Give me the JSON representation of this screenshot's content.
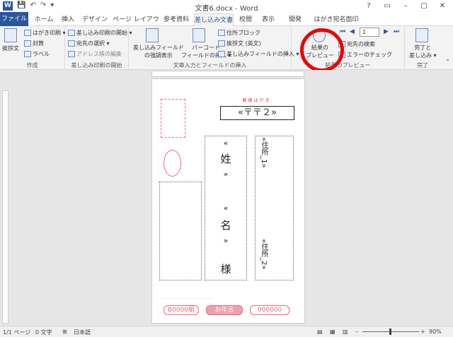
{
  "window": {
    "title": "文書6.docx - Word",
    "controls": [
      "?",
      "▭",
      "–",
      "□",
      "✕"
    ]
  },
  "tabs": [
    {
      "label": "ファイル"
    },
    {
      "label": "ホーム"
    },
    {
      "label": "挿入"
    },
    {
      "label": "デザイン"
    },
    {
      "label": "ページ レイアウト"
    },
    {
      "label": "参考資料"
    },
    {
      "label": "差し込み文書"
    },
    {
      "label": "校閲"
    },
    {
      "label": "表示"
    },
    {
      "label": "開発"
    },
    {
      "label": "はがき宛名面印刷"
    }
  ],
  "ribbon": {
    "create": {
      "label": "作成",
      "greeting": "挨拶文",
      "postcard_print": "はがき印刷",
      "envelope": "封筒",
      "labels": "ラベル"
    },
    "start_merge": {
      "label": "差し込み印刷の開始",
      "start": "差し込み印刷の開始",
      "select_recipients": "宛先の選択",
      "edit_list": "アドレス帳の編集"
    },
    "fields": {
      "label": "文章入力とフィールドの挿入",
      "highlight_line1": "差し込みフィールド",
      "highlight_line2": "の強調表示",
      "barcode_line1": "バーコード",
      "barcode_line2": "フィールドの挿入",
      "address_block": "住所ブロック",
      "greeting_en": "挨拶文 (英文)",
      "insert_field": "差し込みフィールドの挿入"
    },
    "preview": {
      "label": "結果のプレビュー",
      "button_line1": "結果の",
      "button_line2": "プレビュー",
      "record": "1",
      "find_recipient": "宛先の検索",
      "check_errors": "エラーのチェック"
    },
    "finish": {
      "label": "完了",
      "button_line1": "完了と",
      "button_line2": "差し込み"
    }
  },
  "document": {
    "postal_header": "郵便はがき",
    "zip_field": "«〒〒２»",
    "last_name": "«姓»",
    "first_name": "«名»",
    "honorific": "様",
    "address1": "«住所_1»",
    "address2": "«住所_2»",
    "sender_zip": "B0000組",
    "sender_code": "000000",
    "stamp_text": "お年玉"
  },
  "status": {
    "page": "1/1 ページ",
    "words": "0 文字",
    "language": "日本語",
    "zoom": "90%"
  },
  "colors": {
    "accent": "#2b579a",
    "postcard_red": "#e86a7a",
    "highlight_circle": "#e00000"
  }
}
